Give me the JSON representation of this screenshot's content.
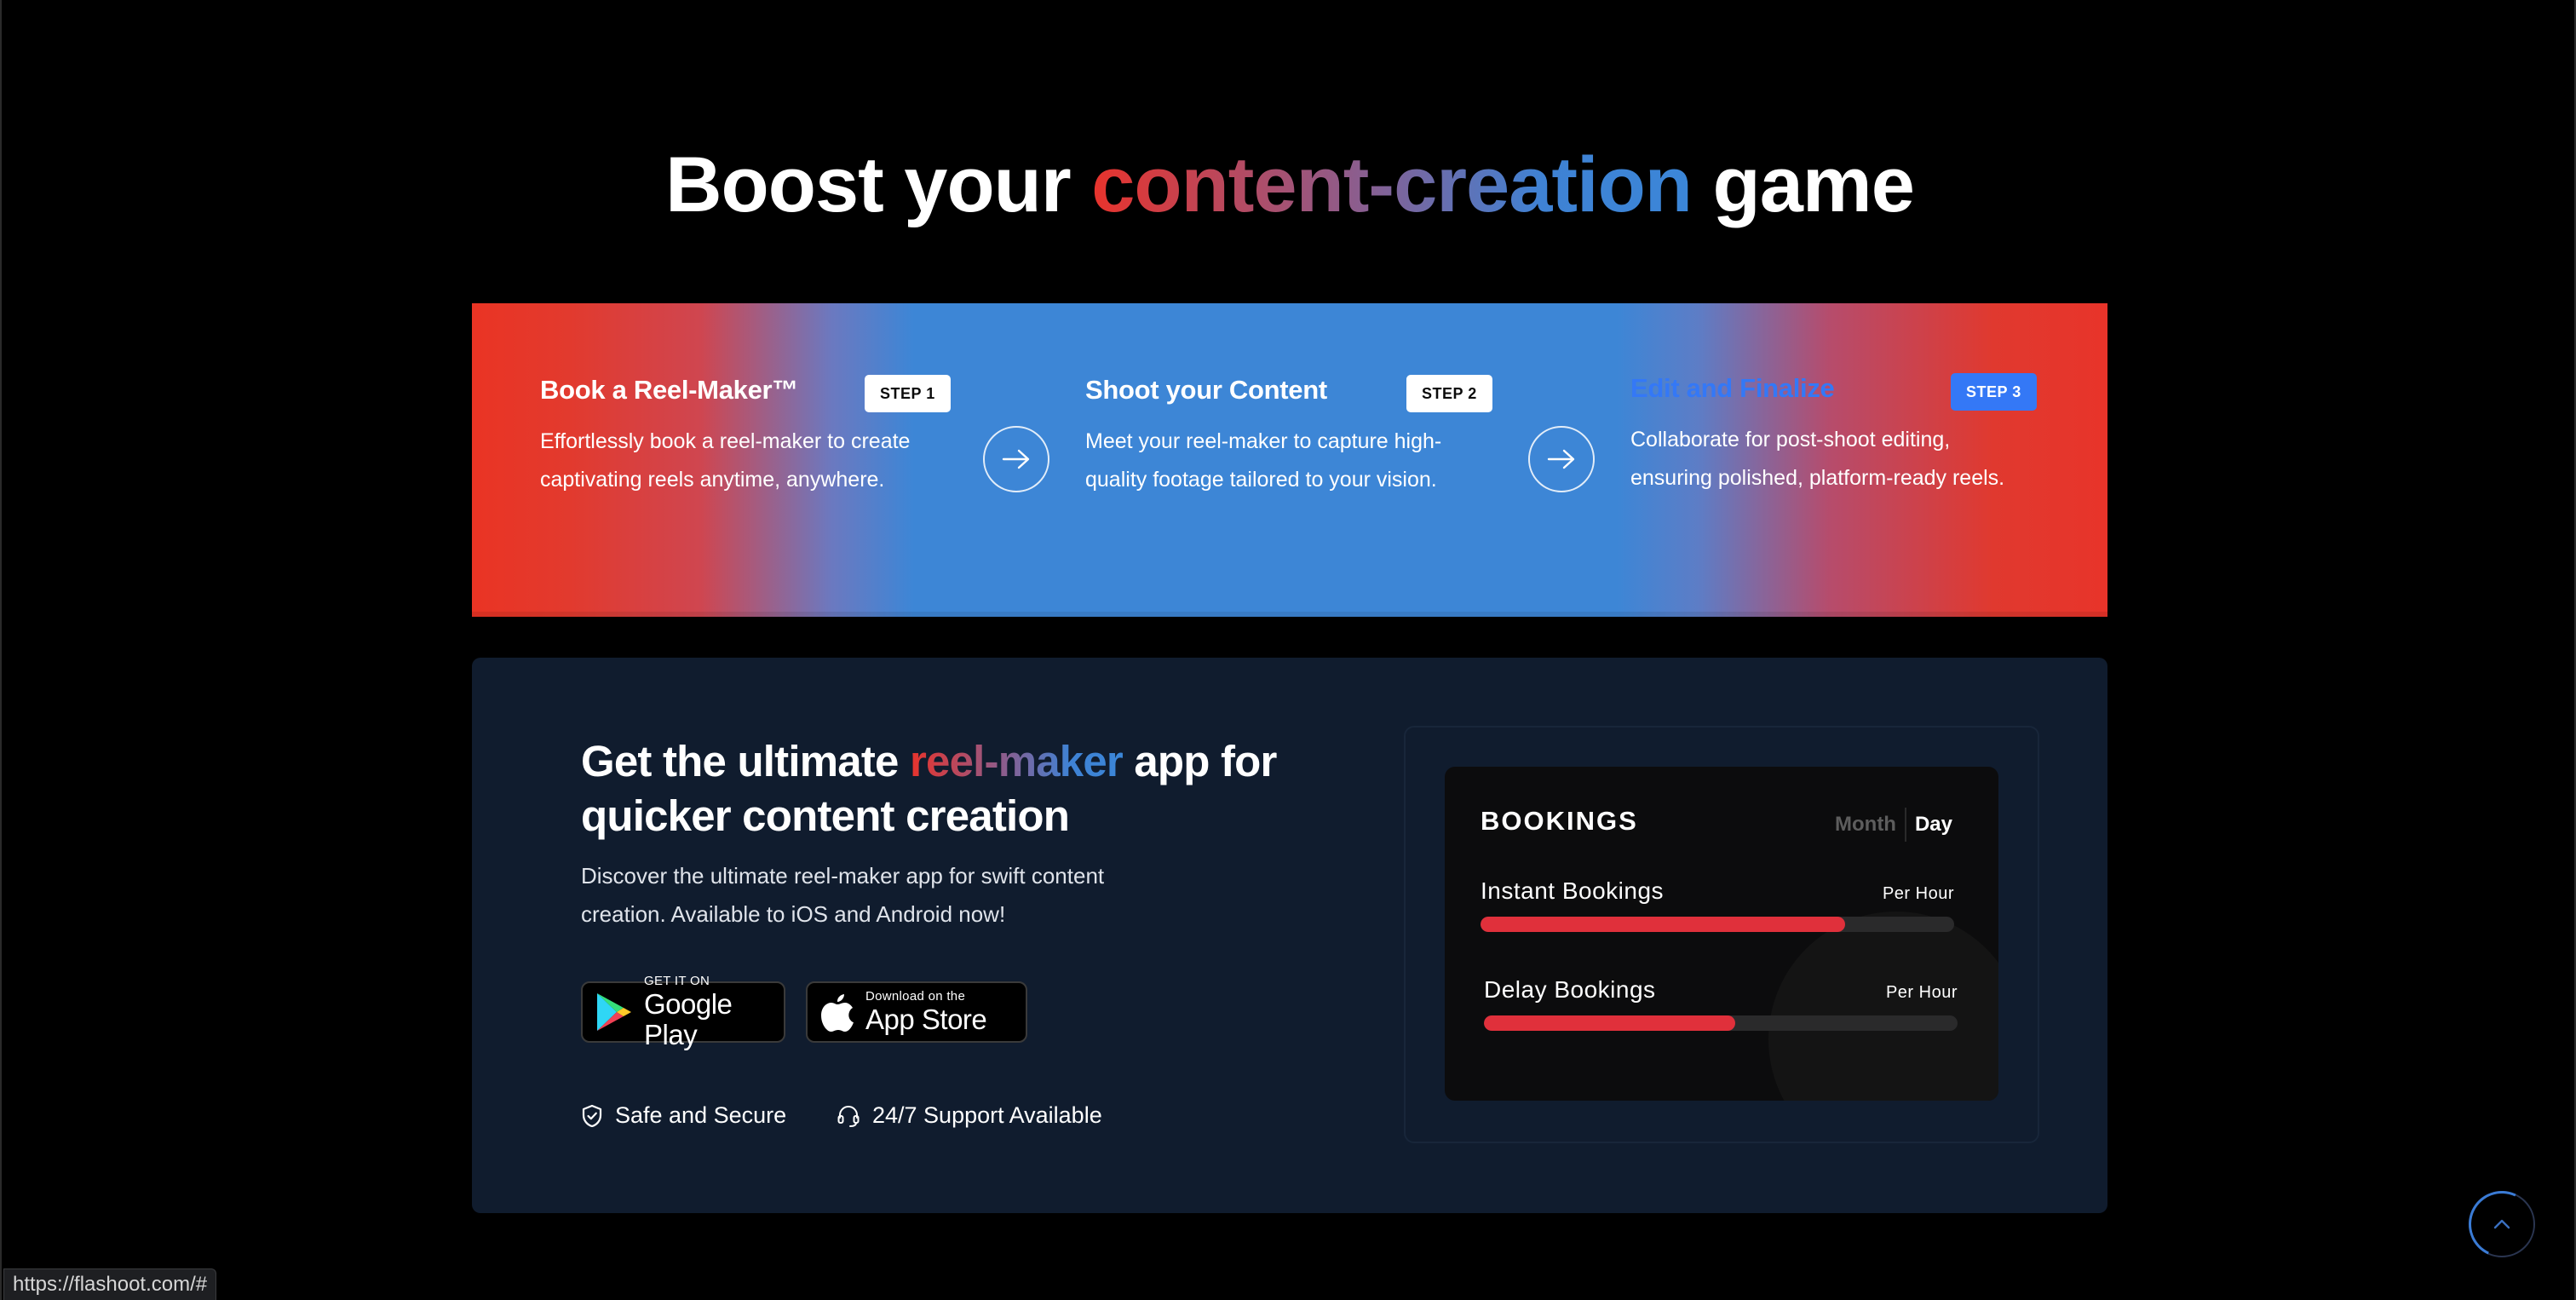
{
  "headline": {
    "before": "Boost your",
    "highlight": "content-creation",
    "after": "game"
  },
  "steps": [
    {
      "title": "Book a Reel-Maker™",
      "badge": "STEP 1",
      "description": "Effortlessly book a reel-maker to create captivating reels anytime, anywhere."
    },
    {
      "title": "Shoot your Content",
      "badge": "STEP 2",
      "description": "Meet your reel-maker to capture high-quality footage tailored to your vision."
    },
    {
      "title": "Edit and Finalize",
      "badge": "STEP 3",
      "description": "Collaborate for post-shoot editing, ensuring polished, platform-ready reels."
    }
  ],
  "app_section": {
    "title_before": "Get the ultimate",
    "title_highlight": "reel-maker",
    "title_after": "app for quicker content creation",
    "description": "Discover the ultimate reel-maker app for swift content creation. Available to iOS and Android now!",
    "google_play": {
      "small": "GET IT ON",
      "big": "Google Play"
    },
    "app_store": {
      "small": "Download on the",
      "big": "App Store"
    },
    "trust": [
      {
        "icon": "shield-check-icon",
        "label": "Safe and Secure"
      },
      {
        "icon": "headset-icon",
        "label": "24/7 Support Available"
      }
    ]
  },
  "bookings_widget": {
    "title": "BOOKINGS",
    "toggle": {
      "month": "Month",
      "day": "Day",
      "active": "Day"
    },
    "rows": [
      {
        "name": "Instant Bookings",
        "unit": "Per Hour",
        "progress": 0.77
      },
      {
        "name": "Delay Bookings",
        "unit": "Per Hour",
        "progress": 0.53
      }
    ],
    "fill_color": "#e0303b"
  },
  "colors": {
    "background": "#000000",
    "card": "#101c2e",
    "accent_red": "#e8332c",
    "accent_blue": "#3d86d6",
    "step3_badge": "#3478f6"
  },
  "status_bar": {
    "url": "https://flashoot.com/#"
  },
  "scroll_top": {
    "icon": "chevron-up-icon"
  }
}
